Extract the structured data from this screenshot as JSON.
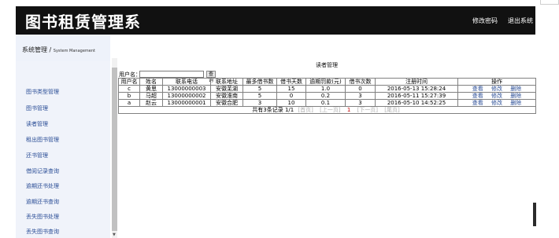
{
  "header": {
    "title": "图书租赁管理系",
    "change_password": "修改密码",
    "logout": "退出系统"
  },
  "system": {
    "title": "系统管理 /",
    "subtitle": "System Management"
  },
  "sidebar": {
    "items": [
      {
        "label": "图书类型管理"
      },
      {
        "label": "图书管理"
      },
      {
        "label": "读者管理"
      },
      {
        "label": "租出图书管理"
      },
      {
        "label": "还书管理"
      },
      {
        "label": "借阅记录查询"
      },
      {
        "label": "逾期还书处理"
      },
      {
        "label": "逾期还书查询"
      },
      {
        "label": "丢失图书处理"
      },
      {
        "label": "丢失图书查询"
      }
    ]
  },
  "main": {
    "title": "读者管理",
    "filter": {
      "label": "用户名：",
      "value": "",
      "button": "查询"
    },
    "table": {
      "headers": [
        "用户名",
        "姓名",
        "联系电话",
        "联系地址",
        "最多借书数",
        "借书天数",
        "逾期罚款(元)",
        "借书次数",
        "注册时间",
        "操作"
      ],
      "rows": [
        {
          "username": "c",
          "name": "黄思",
          "phone": "13000000003",
          "address": "安徽芜湖",
          "max_books": "5",
          "days": "15",
          "fine": "1.0",
          "count": "0",
          "reg_time": "2016-05-13 15:28:24"
        },
        {
          "username": "b",
          "name": "马超",
          "phone": "13000000002",
          "address": "安徽淮南",
          "max_books": "5",
          "days": "0",
          "fine": "0.2",
          "count": "3",
          "reg_time": "2016-05-11 15:27:39"
        },
        {
          "username": "a",
          "name": "赵云",
          "phone": "13000000001",
          "address": "安徽合肥",
          "max_books": "3",
          "days": "10",
          "fine": "0.1",
          "count": "3",
          "reg_time": "2016-05-10 14:52:25"
        }
      ],
      "actions": {
        "view": "查看",
        "edit": "修改",
        "delete": "删除"
      }
    },
    "pager": {
      "summary": "共有3条记录",
      "pages": "1/1",
      "first": "[首页]",
      "prev": "[上一页]",
      "current": "1",
      "next": "[下一页]",
      "last": "[尾页]"
    }
  },
  "colors": {
    "header_bg": "#111111",
    "sidebar_bg": "#f0f3fa",
    "link": "#2a4d96"
  }
}
